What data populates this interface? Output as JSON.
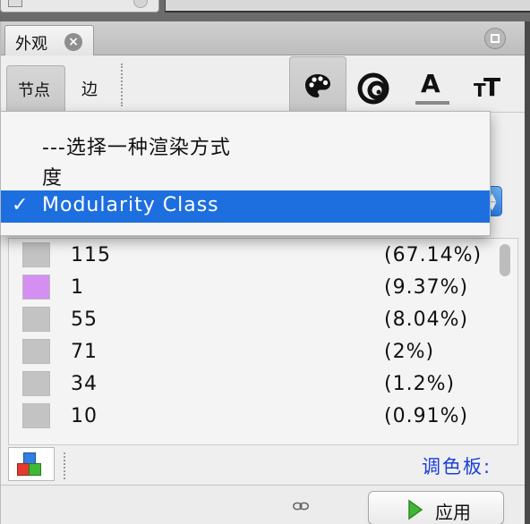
{
  "panel": {
    "tab_title": "外观",
    "close_glyph": "×"
  },
  "toolbar": {
    "node_label": "节点",
    "edge_label": "边",
    "icons": [
      "palette-icon",
      "size-icon",
      "label-color-icon",
      "label-size-icon"
    ],
    "label_color_glyph": "A",
    "label_size_glyph_small": "T",
    "label_size_glyph_large": "T"
  },
  "dropdown": {
    "options": [
      {
        "label": "---选择一种渲染方式",
        "selected": false
      },
      {
        "label": "度",
        "selected": false
      },
      {
        "label": "Modularity Class",
        "selected": true
      }
    ],
    "check_glyph": "✓"
  },
  "partition_list": {
    "rows": [
      {
        "name": "115",
        "percent": "(67.14%)",
        "color": "#c3c3c3"
      },
      {
        "name": "1",
        "percent": "(9.37%)",
        "color": "#d58ef2"
      },
      {
        "name": "55",
        "percent": "(8.04%)",
        "color": "#c3c3c3"
      },
      {
        "name": "71",
        "percent": "(2%)",
        "color": "#c3c3c3"
      },
      {
        "name": "34",
        "percent": "(1.2%)",
        "color": "#c3c3c3"
      },
      {
        "name": "10",
        "percent": "(0.91%)",
        "color": "#c3c3c3"
      }
    ]
  },
  "footer": {
    "palette_link": "调色板:",
    "apply_label": "应用"
  },
  "colors": {
    "selection_blue": "#1d6fe0",
    "link_blue": "#1a3fd6",
    "apply_green": "#3fb833"
  }
}
